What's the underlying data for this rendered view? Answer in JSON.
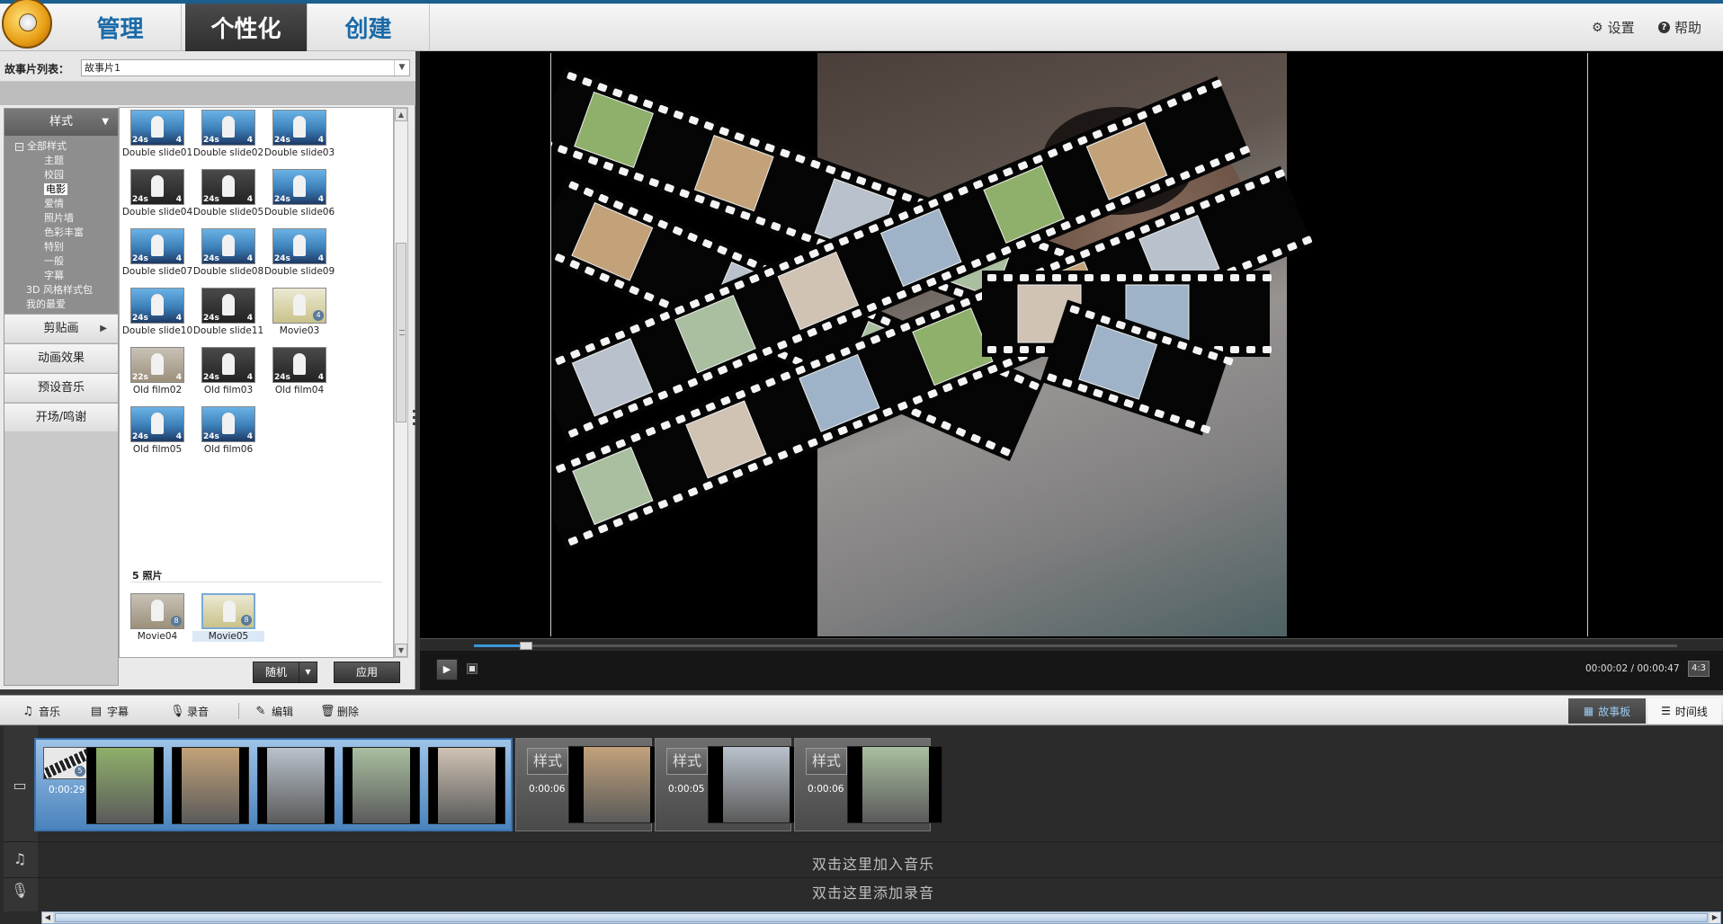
{
  "header": {
    "tabs": [
      {
        "label": "管理",
        "active": false
      },
      {
        "label": "个性化",
        "active": true
      },
      {
        "label": "创建",
        "active": false
      }
    ],
    "settings_label": "设置",
    "help_label": "帮助"
  },
  "story_list": {
    "label": "故事片列表：",
    "selected": "故事片1"
  },
  "categories": {
    "style_header": "样式",
    "tree": [
      {
        "label": "全部样式",
        "level": "root"
      },
      {
        "label": "主题",
        "level": "child"
      },
      {
        "label": "校园",
        "level": "child"
      },
      {
        "label": "电影",
        "level": "child",
        "selected": true
      },
      {
        "label": "爱情",
        "level": "child"
      },
      {
        "label": "照片墙",
        "level": "child"
      },
      {
        "label": "色彩丰富",
        "level": "child"
      },
      {
        "label": "特别",
        "level": "child"
      },
      {
        "label": "一般",
        "level": "child"
      },
      {
        "label": "字幕",
        "level": "child"
      },
      {
        "label": "3D 风格样式包",
        "level": "top"
      },
      {
        "label": "我的最爱",
        "level": "top"
      }
    ],
    "buttons": [
      "剪贴画",
      "动画效果",
      "预设音乐",
      "开场/鸣谢"
    ]
  },
  "templates": [
    {
      "name": "Double slide01",
      "kind": "blue",
      "dur": "24s",
      "count": "4"
    },
    {
      "name": "Double slide02",
      "kind": "blue",
      "dur": "24s",
      "count": "4"
    },
    {
      "name": "Double slide03",
      "kind": "blue",
      "dur": "24s",
      "count": "4"
    },
    {
      "name": "Double slide04",
      "kind": "dark",
      "dur": "24s",
      "count": "4"
    },
    {
      "name": "Double slide05",
      "kind": "dark",
      "dur": "24s",
      "count": "4"
    },
    {
      "name": "Double slide06",
      "kind": "blue",
      "dur": "24s",
      "count": "4"
    },
    {
      "name": "Double slide07",
      "kind": "blue",
      "dur": "24s",
      "count": "4"
    },
    {
      "name": "Double slide08",
      "kind": "blue",
      "dur": "24s",
      "count": "4"
    },
    {
      "name": "Double slide09",
      "kind": "blue",
      "dur": "24s",
      "count": "4"
    },
    {
      "name": "Double slide10",
      "kind": "blue",
      "dur": "24s",
      "count": "4"
    },
    {
      "name": "Double slide11",
      "kind": "dark",
      "dur": "24s",
      "count": "4"
    },
    {
      "name": "Movie03",
      "kind": "film",
      "dur": "",
      "count": "4"
    },
    {
      "name": "Old film02",
      "kind": "old",
      "dur": "22s",
      "count": "4"
    },
    {
      "name": "Old film03",
      "kind": "dark",
      "dur": "24s",
      "count": "4"
    },
    {
      "name": "Old film04",
      "kind": "dark",
      "dur": "24s",
      "count": "4"
    },
    {
      "name": "Old film05",
      "kind": "blue",
      "dur": "24s",
      "count": "4"
    },
    {
      "name": "Old film06",
      "kind": "blue",
      "dur": "24s",
      "count": "4"
    }
  ],
  "five_photo_section": {
    "label": "5 照片",
    "templates": [
      {
        "name": "Movie04",
        "kind": "old",
        "count": "8"
      },
      {
        "name": "Movie05",
        "kind": "film",
        "count": "8",
        "selected": true
      }
    ]
  },
  "template_actions": {
    "random_label": "随机",
    "apply_label": "应用"
  },
  "player": {
    "progress": 0.043,
    "time": "00:00:02 / 00:00:47",
    "aspect": "4:3"
  },
  "bottom_toolbar": {
    "music": "音乐",
    "subtitle": "字幕",
    "record": "录音",
    "edit": "编辑",
    "delete": "删除",
    "storyboard": "故事板",
    "timeline": "时间线"
  },
  "clips": [
    {
      "style": "film",
      "duration": "0:00:29",
      "photos": 5,
      "active": true,
      "badge": "5"
    },
    {
      "style_tag": "样式",
      "duration": "0:00:06",
      "photos": 1,
      "active": false
    },
    {
      "style_tag": "样式",
      "duration": "0:00:05",
      "photos": 1,
      "active": false
    },
    {
      "style_tag": "样式",
      "duration": "0:00:06",
      "photos": 1,
      "active": false
    }
  ],
  "hints": {
    "add_music": "双击这里加入音乐",
    "add_voice": "双击这里添加录音"
  },
  "colors": {
    "accent": "#1a6aa8",
    "progress": "#3a97d8",
    "active_clip": "#4a83bd"
  }
}
